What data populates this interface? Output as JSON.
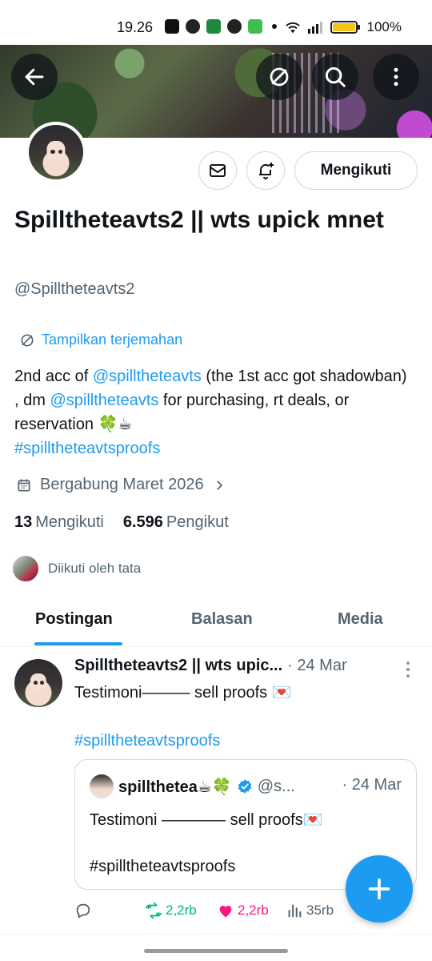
{
  "status_bar": {
    "time": "19.26",
    "battery": "100%"
  },
  "header": {
    "back_icon": "back-arrow-icon",
    "translate_icon": "translate-icon",
    "search_icon": "search-icon",
    "more_icon": "more-vertical-icon"
  },
  "profile": {
    "name": "Spilltheteavts2 || wts upick mnet",
    "handle": "@Spilltheteavts2",
    "follow_button": "Mengikuti",
    "translate_label": "Tampilkan terjemahan",
    "bio": {
      "part1": "2nd acc of ",
      "mention1": "@spilltheteavts",
      "part2": " (the 1st acc got shadowban) , dm ",
      "mention2": "@spilltheteavts",
      "part3": " for purchasing, rt deals, or reservation 🍀☕",
      "hashtag": "#spilltheteavtsproofs"
    },
    "joined": "Bergabung Maret 2026",
    "following_count": "13",
    "following_label": "Mengikuti",
    "followers_count": "6.596",
    "followers_label": "Pengikut",
    "followed_by": "Diikuti oleh tata"
  },
  "tabs": [
    {
      "label": "Postingan",
      "active": true
    },
    {
      "label": "Balasan",
      "active": false
    },
    {
      "label": "Media",
      "active": false
    }
  ],
  "post": {
    "author": "Spilltheteavts2 || wts upic...",
    "date": "· 24 Mar",
    "text": "Testimoni——— sell proofs 💌",
    "hashtag": "#spilltheteavtsproofs",
    "quote": {
      "author": "spillthetea☕🍀",
      "handle": "@s...",
      "date": "· 24 Mar",
      "text": "Testimoni ———— sell proofs💌",
      "hashtag": "#spilltheteavtsproofs"
    },
    "actions": {
      "retweets": "2,2rb",
      "likes": "2,2rb",
      "views": "35rb"
    }
  },
  "colors": {
    "accent": "#1d9bf0",
    "retweet": "#00ba7c",
    "like": "#f91880",
    "muted": "#536471"
  }
}
